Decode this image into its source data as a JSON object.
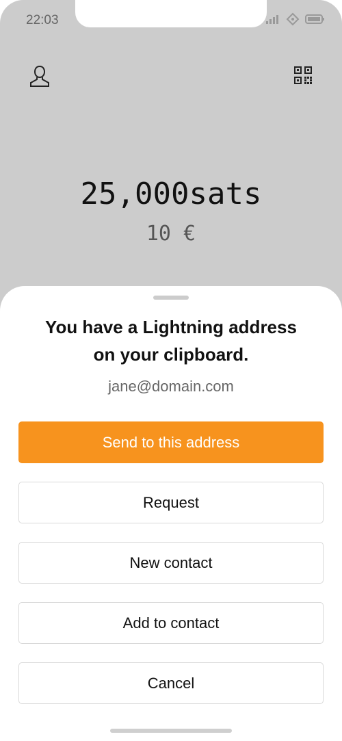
{
  "status_bar": {
    "time": "22:03"
  },
  "header": {
    "profile_icon": "user-icon",
    "scan_icon": "qr-code-icon"
  },
  "balance": {
    "sats": "25,000sats",
    "fiat": "10 €"
  },
  "sheet": {
    "title_line1": "You have a Lightning address",
    "title_line2": "on your clipboard.",
    "address": "jane@domain.com",
    "buttons": {
      "send": "Send to this address",
      "request": "Request",
      "new_contact": "New contact",
      "add_to_contact": "Add to contact",
      "cancel": "Cancel"
    }
  },
  "colors": {
    "accent": "#f7931e",
    "backdrop": "#cccccc"
  }
}
